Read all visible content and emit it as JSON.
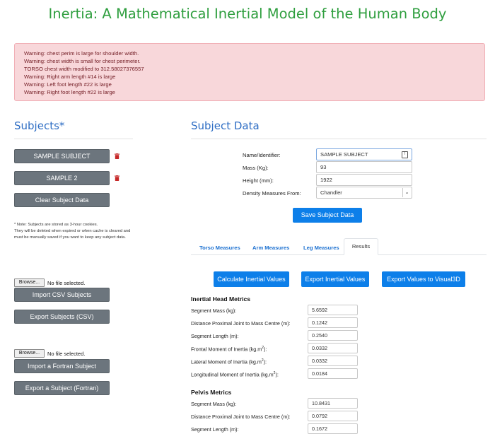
{
  "page_title": "Inertia: A Mathematical Inertial Model of the Human Body",
  "warnings": [
    "Warning: chest perim is large for shoulder width.",
    "Warning: chest width is small for chest perimeter.",
    "TORSO chest width modified to 312.58027376557",
    "Warning: Right arm length #14 is large",
    "Warning: Left foot length #22 is large",
    "Warning: Right foot length #22 is large"
  ],
  "subjects": {
    "heading": "Subjects*",
    "items": [
      {
        "label": "SAMPLE SUBJECT"
      },
      {
        "label": "SAMPLE 2"
      }
    ],
    "clear_label": "Clear Subject Data",
    "note_lines": [
      "* Note: Subjects are stored as 3-hour cookies.",
      "They will be deleted when expired or when cache is cleared and",
      "must be manually saved if you want to keep any subject data."
    ],
    "browse_label": "Browse...",
    "no_file_label": "No file selected.",
    "import_csv_label": "Import CSV Subjects",
    "export_csv_label": "Export Subjects (CSV)",
    "import_fortran_label": "Import a Fortran Subject",
    "export_fortran_label": "Export a Subject (Fortran)"
  },
  "subject_data": {
    "heading": "Subject Data",
    "name_label": "Name/Identifier:",
    "name_value": "SAMPLE SUBJECT",
    "mass_label": "Mass (Kg):",
    "mass_value": "93",
    "height_label": "Height (mm):",
    "height_value": "1922",
    "density_label": "Density Measures From:",
    "density_value": "Chandler",
    "save_label": "Save Subject Data"
  },
  "tabs": [
    {
      "label": "Torso Measures"
    },
    {
      "label": "Arm Measures"
    },
    {
      "label": "Leg Measures"
    },
    {
      "label": "Results"
    }
  ],
  "results": {
    "calculate_label": "Calculate Inertial Values",
    "export_label": "Export Inertial Values",
    "visual3d_label": "Export Values to Visual3D",
    "head": {
      "heading": "Inertial Head Metrics",
      "rows": [
        {
          "label": "Segment Mass (kg):",
          "value": "5.6592"
        },
        {
          "label": "Distance Proximal Joint to Mass Centre (m):",
          "value": "0.1242"
        },
        {
          "label": "Segment Length (m):",
          "value": "0.2540"
        },
        {
          "label": "Frontal Moment of Inertia (kg.m",
          "value": "0.0332"
        },
        {
          "label": "Lateral Moment of Inertia (kg.m",
          "value": "0.0332"
        },
        {
          "label": "Longitudinal Moment of Inertia (kg.m",
          "value": "0.0184"
        }
      ],
      "sup": "2",
      "close": "):"
    },
    "pelvis": {
      "heading": "Pelvis Metrics",
      "rows": [
        {
          "label": "Segment Mass (kg):",
          "value": "10.8431"
        },
        {
          "label": "Distance Proximal Joint to Mass Centre (m):",
          "value": "0.0792"
        },
        {
          "label": "Segment Length (m):",
          "value": "0.1672"
        }
      ]
    }
  },
  "colors": {
    "title_green": "#2e9e3e",
    "heading_blue": "#2f6ec4",
    "primary_button": "#0d7fe9",
    "secondary_button": "#6c757d",
    "warning_bg": "#f8d7da",
    "warning_text": "#721c24",
    "trash_red": "#c62828"
  }
}
